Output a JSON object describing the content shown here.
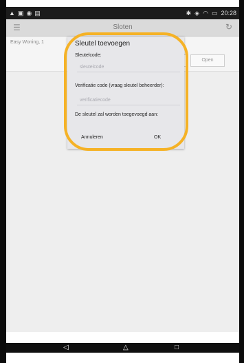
{
  "status_bar": {
    "left_icons": [
      "warning-icon",
      "image-icon",
      "chrome-icon",
      "gallery-icon"
    ],
    "right_icons": [
      "bluetooth-icon",
      "vibrate-icon",
      "wifi-icon",
      "battery-icon"
    ],
    "time": "20:28"
  },
  "app_bar": {
    "title": "Sloten",
    "menu_icon": "menu-icon",
    "refresh_icon": "refresh-icon"
  },
  "lock_list": {
    "items": [
      {
        "name": "Easy Woning, 1",
        "open_label": "Open"
      }
    ]
  },
  "dialog": {
    "title": "Sleutel toevoegen",
    "key_code_label": "Sleutelcode:",
    "key_code_placeholder": "sleutelcode",
    "verification_label": "Verificatie code (vraag sleutel beheerder):",
    "verification_placeholder": "verificatiecode",
    "added_to_label": "De sleutel zal worden toegevoegd aan:",
    "cancel_label": "Annuleren",
    "ok_label": "OK"
  },
  "nav_bar": {
    "back": "◁",
    "home": "△",
    "recents": "□"
  },
  "colors": {
    "highlight": "#f5b226",
    "dialog_bg": "#e7e7ea",
    "status_bar": "#1c1c1c"
  }
}
